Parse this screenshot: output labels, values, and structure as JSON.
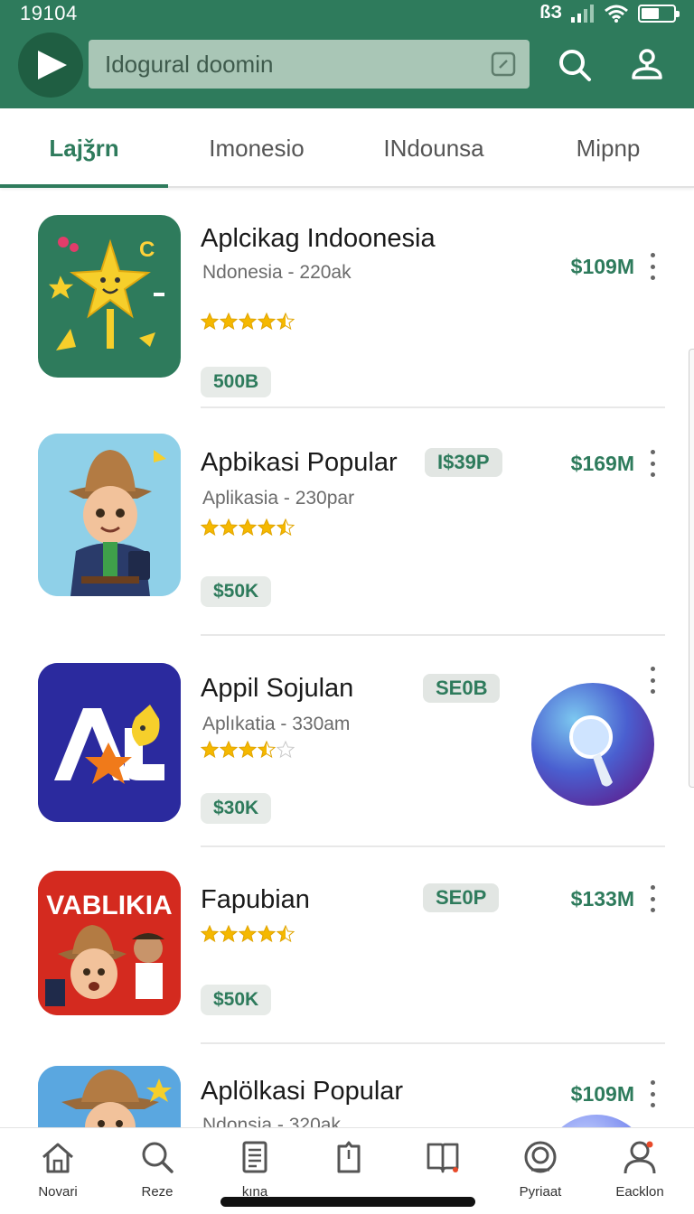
{
  "status_bar": {
    "time": "19104",
    "carrier": "ßЗ",
    "battery_level": 0.55
  },
  "header": {
    "search_text": "Idogural doomin",
    "logo_icon": "play-triangle-icon",
    "brand_color": "#2e7b5c"
  },
  "tabs": [
    {
      "label": "Lajǯrn",
      "active": true
    },
    {
      "label": "Imonesio",
      "active": false
    },
    {
      "label": "INdounsa",
      "active": false
    },
    {
      "label": "Mipnp",
      "active": false
    }
  ],
  "apps": [
    {
      "title": "Aplcikag Indoonesia",
      "subtitle": "Ndonesia - 220ak",
      "rating": 4.5,
      "badge": "500B",
      "tag": "",
      "price": "$109M",
      "icon": "star-character-icon",
      "icon_bg": "#2e7b5c"
    },
    {
      "title": "Apbikasi Popular",
      "subtitle": "Aplikasia - 230par",
      "rating": 4.5,
      "badge": "$50K",
      "tag": "I$39P",
      "price": "$169M",
      "icon": "cowboy-boy-icon",
      "icon_bg": "#8fd0e8"
    },
    {
      "title": "Appil Sojulan",
      "subtitle": "Aplıkatia - 330am",
      "rating": 3.5,
      "badge": "$30K",
      "tag": "SE0B",
      "price": "",
      "icon": "letter-a-star-icon",
      "icon_bg": "#2b2a9e"
    },
    {
      "title": "Fapubian",
      "subtitle": "",
      "rating": 4.5,
      "badge": "$50K",
      "tag": "SE0P",
      "price": "$133M",
      "icon": "vablikia-game-icon",
      "icon_bg": "#d42a1f",
      "icon_text": "VABLIKIA"
    },
    {
      "title": "Aplölkasi Popular",
      "subtitle": "Ndonsia - 320ak",
      "rating": 0,
      "badge": "",
      "tag": "",
      "price": "$109M",
      "icon": "cowboy-boy-icon",
      "icon_bg": "#5aa7e0"
    }
  ],
  "bottom_nav": [
    {
      "label": "Novari",
      "icon": "home-icon"
    },
    {
      "label": "Reze",
      "icon": "search-icon"
    },
    {
      "label": "kına",
      "icon": "document-icon"
    },
    {
      "label": "",
      "icon": "bookmark-icon"
    },
    {
      "label": "",
      "icon": "book-icon"
    },
    {
      "label": "Pyriaat",
      "icon": "camera-icon"
    },
    {
      "label": "Eacklon",
      "icon": "profile-icon"
    }
  ]
}
